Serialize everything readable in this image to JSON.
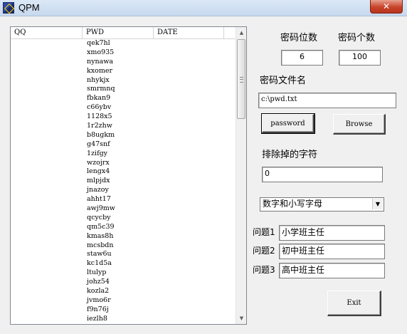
{
  "window": {
    "title": "QPM",
    "close_glyph": "✕",
    "icon": "app-logo-icon"
  },
  "list": {
    "columns": [
      "QQ",
      "PWD",
      "DATE"
    ],
    "rows": [
      {
        "qq": "",
        "pwd": "qek7hl",
        "date": ""
      },
      {
        "qq": "",
        "pwd": "xmo935",
        "date": ""
      },
      {
        "qq": "",
        "pwd": "nynawa",
        "date": ""
      },
      {
        "qq": "",
        "pwd": "kxomer",
        "date": ""
      },
      {
        "qq": "",
        "pwd": "nhykjx",
        "date": ""
      },
      {
        "qq": "",
        "pwd": "smrmnq",
        "date": ""
      },
      {
        "qq": "",
        "pwd": "fbkan9",
        "date": ""
      },
      {
        "qq": "",
        "pwd": "c66ybv",
        "date": ""
      },
      {
        "qq": "",
        "pwd": "1128x5",
        "date": ""
      },
      {
        "qq": "",
        "pwd": "1r2zhw",
        "date": ""
      },
      {
        "qq": "",
        "pwd": "b8ugkm",
        "date": ""
      },
      {
        "qq": "",
        "pwd": "g47snf",
        "date": ""
      },
      {
        "qq": "",
        "pwd": "1zifgy",
        "date": ""
      },
      {
        "qq": "",
        "pwd": "wzojrx",
        "date": ""
      },
      {
        "qq": "",
        "pwd": "lengx4",
        "date": ""
      },
      {
        "qq": "",
        "pwd": "mlpjdx",
        "date": ""
      },
      {
        "qq": "",
        "pwd": "jnazoy",
        "date": ""
      },
      {
        "qq": "",
        "pwd": "ahht17",
        "date": ""
      },
      {
        "qq": "",
        "pwd": "awj9mw",
        "date": ""
      },
      {
        "qq": "",
        "pwd": "qcycby",
        "date": ""
      },
      {
        "qq": "",
        "pwd": "qm5c39",
        "date": ""
      },
      {
        "qq": "",
        "pwd": "kmas8h",
        "date": ""
      },
      {
        "qq": "",
        "pwd": "mcsbdn",
        "date": ""
      },
      {
        "qq": "",
        "pwd": "staw6u",
        "date": ""
      },
      {
        "qq": "",
        "pwd": "kc1d5a",
        "date": ""
      },
      {
        "qq": "",
        "pwd": "ltulyp",
        "date": ""
      },
      {
        "qq": "",
        "pwd": "johz54",
        "date": ""
      },
      {
        "qq": "",
        "pwd": "kozla2",
        "date": ""
      },
      {
        "qq": "",
        "pwd": "jvmo6r",
        "date": ""
      },
      {
        "qq": "",
        "pwd": "f9n76j",
        "date": ""
      },
      {
        "qq": "",
        "pwd": "iezlh8",
        "date": ""
      }
    ]
  },
  "settings": {
    "digits_label": "密码位数",
    "digits_value": "6",
    "count_label": "密码个数",
    "count_value": "100",
    "file_label": "密码文件名",
    "file_value": "c:\\pwd.txt",
    "password_button": "password",
    "browse_button": "Browse",
    "exclude_label": "排除掉的字符",
    "exclude_value": "0",
    "charset_selected": "数字和小写字母",
    "questions": [
      {
        "label": "问题1",
        "value": "小学班主任"
      },
      {
        "label": "问题2",
        "value": "初中班主任"
      },
      {
        "label": "问题3",
        "value": "高中班主任"
      }
    ],
    "exit_button": "Exit"
  },
  "scroll": {
    "up_glyph": "▲",
    "down_glyph": "▼",
    "dropdown_glyph": "▼"
  }
}
